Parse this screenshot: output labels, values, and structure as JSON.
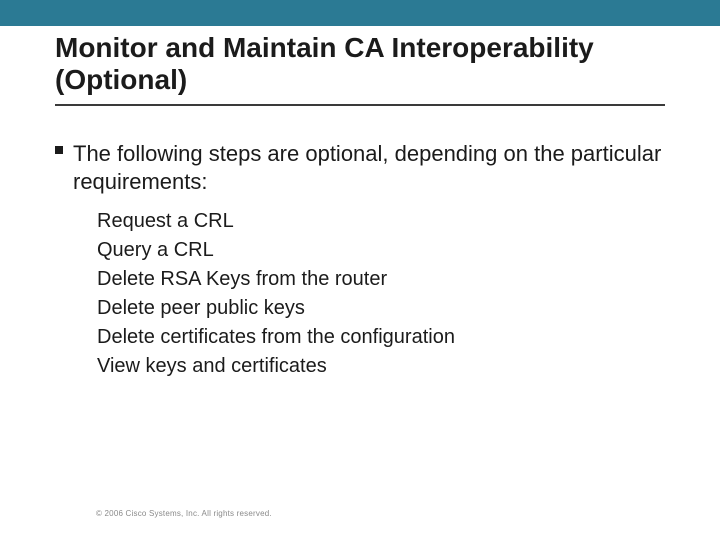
{
  "title": "Monitor and Maintain CA Interoperability (Optional)",
  "lead": "The following steps are optional, depending on the particular requirements:",
  "items": [
    "Request a CRL",
    "Query a CRL",
    "Delete RSA Keys from the router",
    "Delete peer public keys",
    "Delete certificates from the configuration",
    "View keys and certificates"
  ],
  "footer": "© 2006 Cisco Systems, Inc. All rights reserved.",
  "colors": {
    "accent": "#2b7a94"
  }
}
